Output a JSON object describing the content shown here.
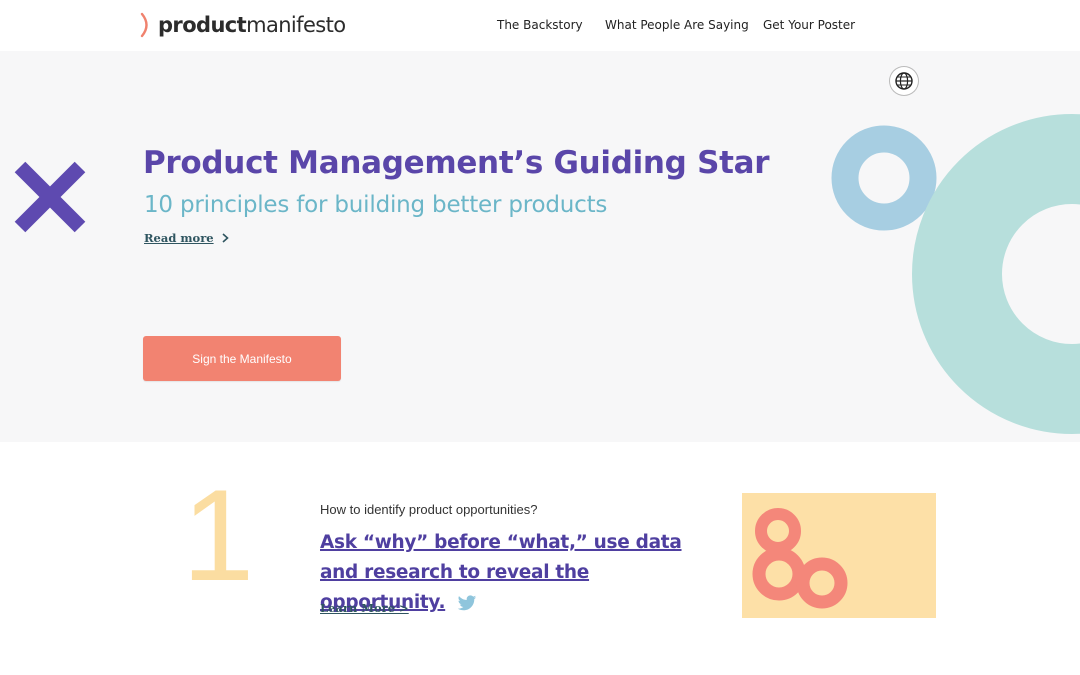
{
  "header": {
    "logo": {
      "part1": "product",
      "part2": "manifesto"
    },
    "nav": [
      "The Backstory",
      "What People Are Saying",
      "Get Your Poster"
    ]
  },
  "hero": {
    "title": "Product Management’s Guiding Star",
    "subtitle": "10 principles for building better products",
    "read_more": "Read more",
    "cta": "Sign the Manifesto"
  },
  "principle": {
    "number": "1",
    "question": "How to identify product opportunities?",
    "statement": "Ask “why” before “what,” use data and research to reveal the opportunity.",
    "learn_more": "Learn More >"
  },
  "icons": [
    "logo-arc-icon",
    "globe-icon",
    "x-shape-icon",
    "chevron-right-icon",
    "twitter-icon",
    "circle-illustration-icon"
  ],
  "colors": {
    "purple": "#5a46a9",
    "teal_text": "#6bb6c8",
    "cta": "#f28371",
    "ring_blue": "#a7cee2",
    "ring_mint": "#b7dfdc",
    "peach_number": "#fbdda1",
    "illustration_bg": "#fde0a7",
    "illustration_ring": "#f4877a"
  }
}
